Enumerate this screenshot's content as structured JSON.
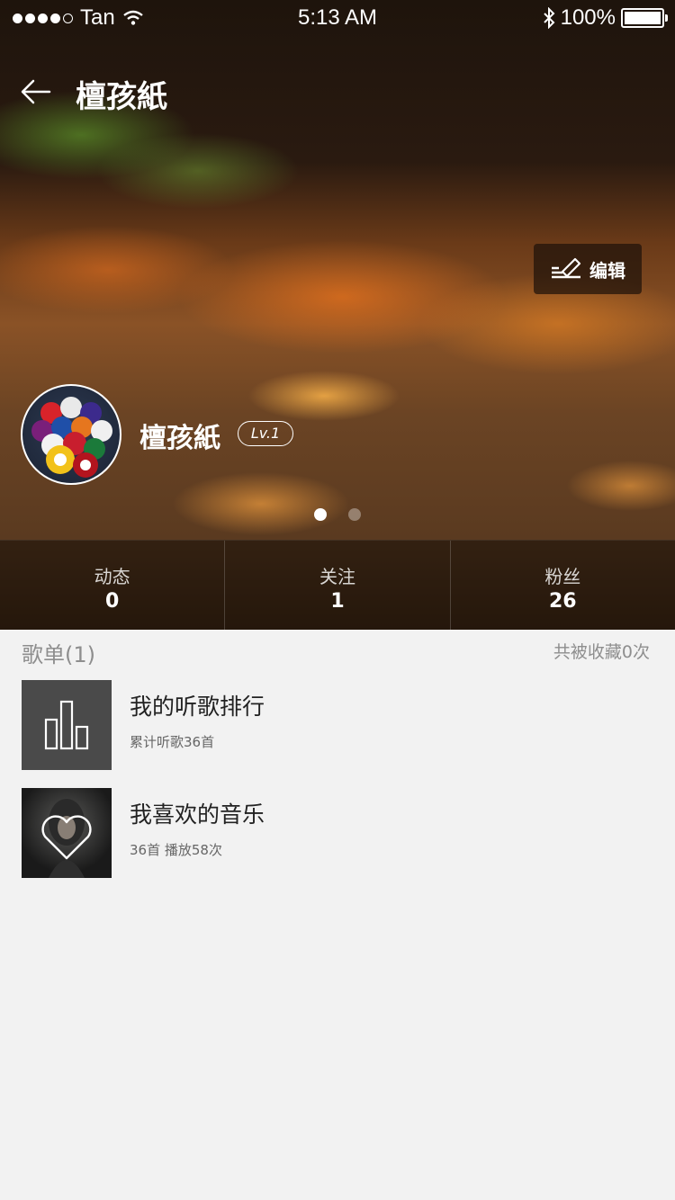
{
  "status_bar": {
    "carrier": "Tan",
    "time": "5:13 AM",
    "battery": "100%",
    "battery_level": 1.0
  },
  "nav": {
    "title": "檀孩紙",
    "back_icon": "back-arrow-icon"
  },
  "hero": {
    "edit_label": "编辑",
    "edit_icon": "pencil-edit-icon",
    "username": "檀孩紙",
    "level": "Lv.1",
    "pager": {
      "count": 2,
      "active": 0
    }
  },
  "stats": [
    {
      "label": "动态",
      "value": "0"
    },
    {
      "label": "关注",
      "value": "1"
    },
    {
      "label": "粉丝",
      "value": "26"
    }
  ],
  "playlists": {
    "header": "歌单(1)",
    "collected": "共被收藏0次",
    "items": [
      {
        "title": "我的听歌排行",
        "subtitle": "累计听歌36首",
        "icon": "bar-chart-icon"
      },
      {
        "title": "我喜欢的音乐",
        "subtitle": "36首 播放58次",
        "icon": "heart-icon"
      }
    ]
  }
}
